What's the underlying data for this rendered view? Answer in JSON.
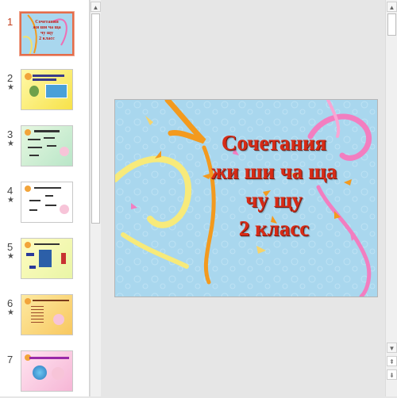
{
  "slides": [
    {
      "number": "1",
      "animated": false,
      "title_lines": [
        "Сочетания",
        "жи ши ча ща",
        "чу щу",
        "2 класс"
      ]
    },
    {
      "number": "2",
      "animated": true
    },
    {
      "number": "3",
      "animated": true
    },
    {
      "number": "4",
      "animated": true
    },
    {
      "number": "5",
      "animated": true
    },
    {
      "number": "6",
      "animated": true
    },
    {
      "number": "7",
      "animated": false
    }
  ],
  "star_glyph": "★",
  "icons": {
    "scroll_up": "scroll-up-arrow-icon",
    "scroll_down": "scroll-down-arrow-icon",
    "prev_slide": "previous-slide-icon",
    "next_slide": "next-slide-icon"
  },
  "glyphs": {
    "up": "▲",
    "down": "▼",
    "prev": "⇞",
    "next": "⇟"
  },
  "main_slide": {
    "title_lines": [
      "Сочетания",
      "жи ши ча ща",
      "чу щу",
      "2 класс"
    ],
    "background": "#a9d7ee",
    "title_color": "#d72b16"
  },
  "colors": {
    "selection": "#e46c4a"
  }
}
